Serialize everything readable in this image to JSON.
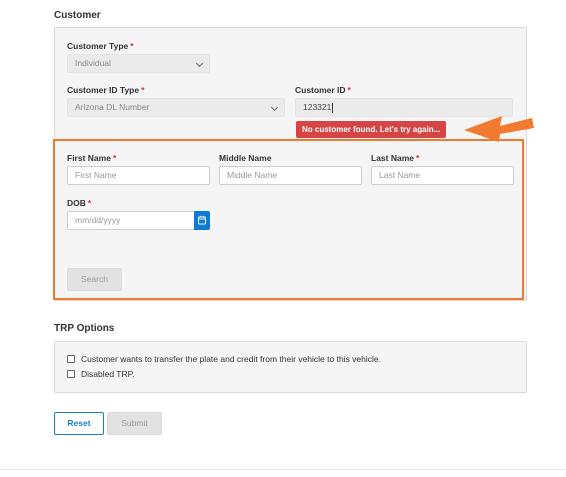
{
  "customer_section": {
    "title": "Customer",
    "customer_type": {
      "label": "Customer Type",
      "required": "*",
      "value": "Individual"
    },
    "customer_id_type": {
      "label": "Customer ID Type",
      "required": "*",
      "value": "Arizona DL Number"
    },
    "customer_id": {
      "label": "Customer ID",
      "required": "*",
      "value": "123321"
    },
    "error_tooltip": "No customer found. Let's try again...",
    "first_name": {
      "label": "First Name",
      "required": "*",
      "placeholder": "First Name"
    },
    "middle_name": {
      "label": "Middle Name",
      "placeholder": "Middle Name"
    },
    "last_name": {
      "label": "Last Name",
      "required": "*",
      "placeholder": "Last Name"
    },
    "dob": {
      "label": "DOB",
      "required": "*",
      "placeholder": "mm/dd/yyyy",
      "icon": "calendar-icon"
    },
    "search_button": "Search"
  },
  "trp_section": {
    "title": "TRP Options",
    "options": [
      {
        "label": "Customer wants to transfer the plate and credit from their vehicle to this vehicle.",
        "checked": false
      },
      {
        "label": "Disabled TRP.",
        "checked": false
      }
    ]
  },
  "actions": {
    "reset": "Reset",
    "submit": "Submit"
  },
  "colors": {
    "highlight": "#f07a2f",
    "error": "#d64545",
    "primary": "#1680c6",
    "required": "#d9282f"
  }
}
